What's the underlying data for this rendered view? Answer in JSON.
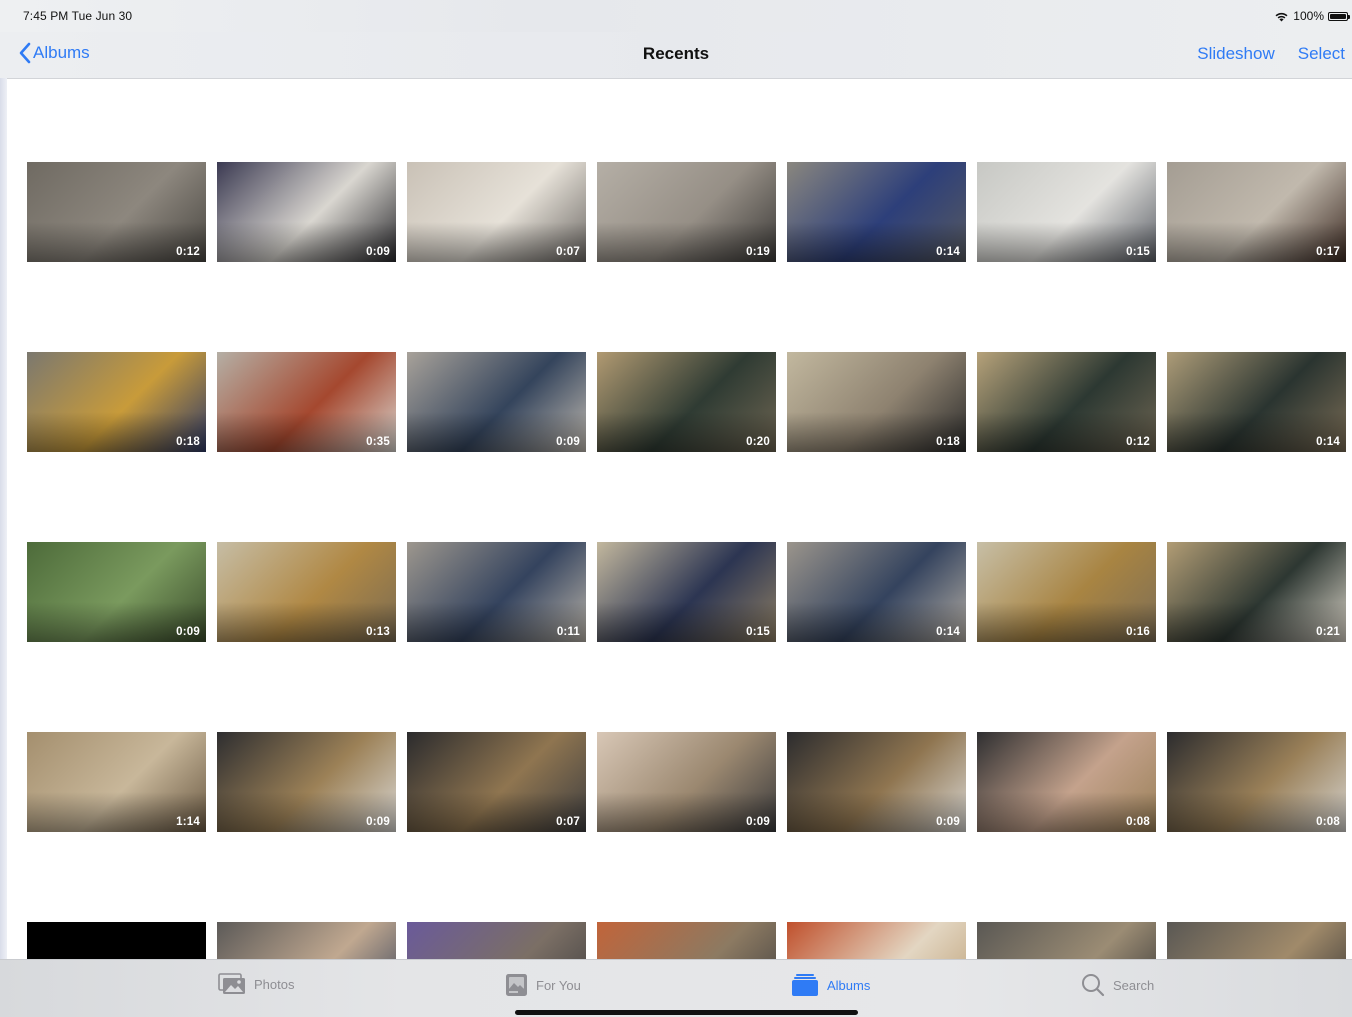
{
  "status": {
    "time": "7:45 PM   Tue Jun 30",
    "battery": "100%"
  },
  "nav": {
    "back_label": "Albums",
    "title": "Recents",
    "slideshow_label": "Slideshow",
    "select_label": "Select"
  },
  "rows": [
    {
      "items": [
        {
          "duration": "0:12",
          "colors": [
            "#6f6a62",
            "#8d877e",
            "#4a4742"
          ]
        },
        {
          "duration": "0:09",
          "colors": [
            "#3b3a52",
            "#d9d6d0",
            "#2a2a2e"
          ]
        },
        {
          "duration": "0:07",
          "colors": [
            "#c9c1b6",
            "#e6e1d8",
            "#6e6a66"
          ]
        },
        {
          "duration": "0:19",
          "colors": [
            "#b5afa6",
            "#968f86",
            "#3c3a38"
          ]
        },
        {
          "duration": "0:14",
          "colors": [
            "#8a877f",
            "#2d3f7a",
            "#575a60"
          ]
        },
        {
          "duration": "0:15",
          "colors": [
            "#c7c8c4",
            "#e4e3df",
            "#5c6068"
          ]
        },
        {
          "duration": "0:17",
          "colors": [
            "#a49d93",
            "#c1b9ad",
            "#3c2a22"
          ]
        }
      ]
    },
    {
      "items": [
        {
          "duration": "0:18",
          "colors": [
            "#7b786f",
            "#c89b3a",
            "#2f3a67"
          ]
        },
        {
          "duration": "0:35",
          "colors": [
            "#b5afa5",
            "#a5482f",
            "#d9d5cf"
          ]
        },
        {
          "duration": "0:09",
          "colors": [
            "#a8a29a",
            "#34445c",
            "#bfb9b0"
          ]
        },
        {
          "duration": "0:20",
          "colors": [
            "#b19a72",
            "#2f3b33",
            "#6e6552"
          ]
        },
        {
          "duration": "0:18",
          "colors": [
            "#c2b89f",
            "#8e8270",
            "#2b2b2b"
          ]
        },
        {
          "duration": "0:12",
          "colors": [
            "#b6a27a",
            "#2c3832",
            "#6e6552"
          ]
        },
        {
          "duration": "0:14",
          "colors": [
            "#ad9c78",
            "#2a3430",
            "#7a6c55"
          ]
        }
      ]
    },
    {
      "items": [
        {
          "duration": "0:09",
          "colors": [
            "#4d6b3a",
            "#7a9a5e",
            "#3b4d2c"
          ]
        },
        {
          "duration": "0:13",
          "colors": [
            "#c6bda5",
            "#b08844",
            "#7a6b52"
          ]
        },
        {
          "duration": "0:11",
          "colors": [
            "#9d978e",
            "#34435e",
            "#b8b2a8"
          ]
        },
        {
          "duration": "0:15",
          "colors": [
            "#c3b89e",
            "#2c3552",
            "#8e7f64"
          ]
        },
        {
          "duration": "0:14",
          "colors": [
            "#9b958c",
            "#34435e",
            "#b3ada4"
          ]
        },
        {
          "duration": "0:16",
          "colors": [
            "#c7bfa7",
            "#a88442",
            "#7d6e56"
          ]
        },
        {
          "duration": "0:21",
          "colors": [
            "#b29d75",
            "#2d3732",
            "#d8d2c6"
          ]
        }
      ]
    },
    {
      "items": [
        {
          "duration": "1:14",
          "colors": [
            "#a48f6e",
            "#c8b79a",
            "#6b5a44"
          ]
        },
        {
          "duration": "0:09",
          "colors": [
            "#2e2e30",
            "#9c8157",
            "#d9d7d3"
          ]
        },
        {
          "duration": "0:07",
          "colors": [
            "#2b2b2d",
            "#8f7550",
            "#3e3e40"
          ]
        },
        {
          "duration": "0:09",
          "colors": [
            "#d8c7b6",
            "#9b8870",
            "#3a3a3c"
          ]
        },
        {
          "duration": "0:09",
          "colors": [
            "#2c2c2e",
            "#8f7550",
            "#d9d7d3"
          ]
        },
        {
          "duration": "0:08",
          "colors": [
            "#2f2f31",
            "#c4a28c",
            "#9a8058"
          ]
        },
        {
          "duration": "0:08",
          "colors": [
            "#2c2c2e",
            "#9a8058",
            "#d5d3cf"
          ]
        }
      ]
    },
    {
      "items": [
        {
          "duration": "",
          "colors": [
            "#000000",
            "#000000",
            "#000000"
          ]
        },
        {
          "duration": "",
          "colors": [
            "#5c5a58",
            "#c0a890",
            "#2c3a55"
          ]
        },
        {
          "duration": "",
          "colors": [
            "#6a5a9a",
            "#7b6f65",
            "#3a3a3c"
          ]
        },
        {
          "duration": "",
          "colors": [
            "#c1643a",
            "#8c7a62",
            "#3a3a3c"
          ]
        },
        {
          "duration": "",
          "colors": [
            "#c0502c",
            "#e3d6c2",
            "#b89a6e"
          ]
        },
        {
          "duration": "",
          "colors": [
            "#5a5854",
            "#9b8c74",
            "#2e2e30"
          ]
        },
        {
          "duration": "",
          "colors": [
            "#5a5854",
            "#a08a6a",
            "#2e2e30"
          ]
        }
      ]
    }
  ],
  "tabs": [
    {
      "label": "Photos",
      "icon": "photos-icon",
      "active": false
    },
    {
      "label": "For You",
      "icon": "for-you-icon",
      "active": false
    },
    {
      "label": "Albums",
      "icon": "albums-icon",
      "active": true
    },
    {
      "label": "Search",
      "icon": "search-icon",
      "active": false
    }
  ],
  "colors": {
    "accent": "#2f7bf5",
    "inactive": "#8e8e93"
  }
}
